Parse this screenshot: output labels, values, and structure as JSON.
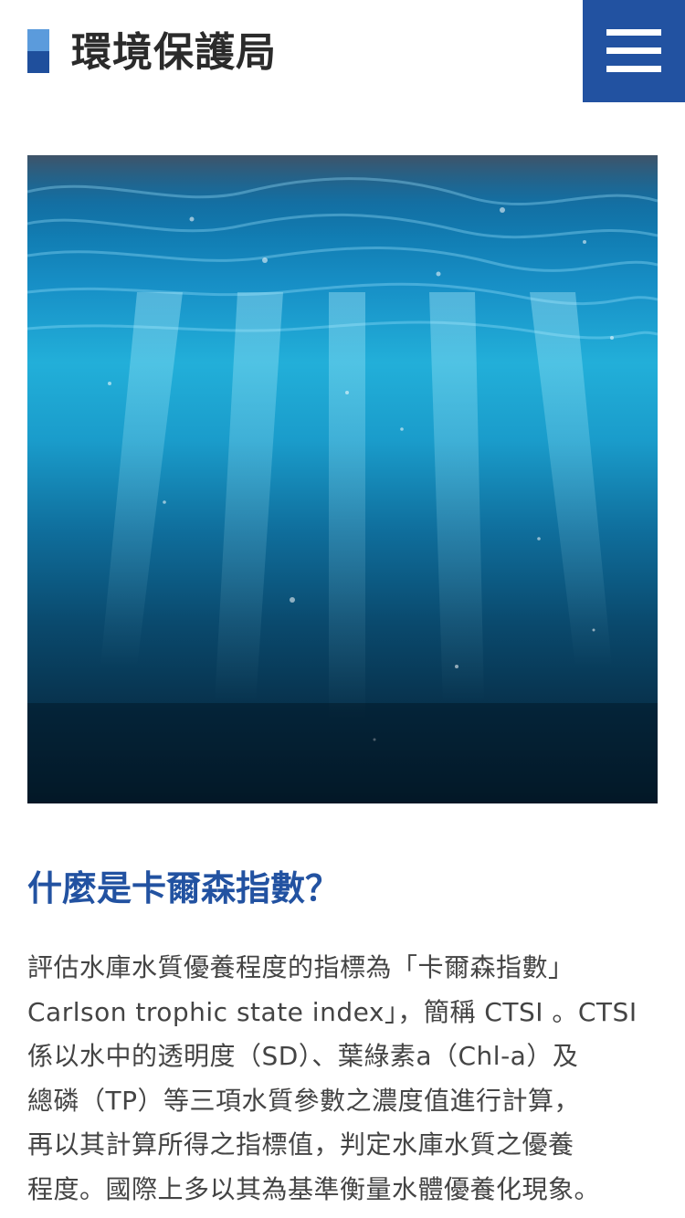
{
  "header": {
    "title": "環境保護局",
    "menu_icon": "hamburger-menu-icon",
    "accent_color": "#2252a1",
    "logo_colors": [
      "#5b9bdc",
      "#1f4f9c"
    ]
  },
  "hero": {
    "image": "underwater-ocean-image"
  },
  "article": {
    "heading": "什麼是卡爾森指數？",
    "heading_color": "#2252a1",
    "lines": [
      "評估水庫水質優養程度的指標為「卡爾森指數」",
      "Carlson trophic state index」，簡稱 CTSI 。CTSI",
      "係以水中的透明度（SD）、葉綠素a（Chl-a）及",
      "總磷（TP）等三項水質參數之濃度值進行計算，",
      "再以其計算所得之指標值，判定水庫水質之優養",
      "程度。國際上多以其為基準衡量水體優養化現象。"
    ]
  }
}
